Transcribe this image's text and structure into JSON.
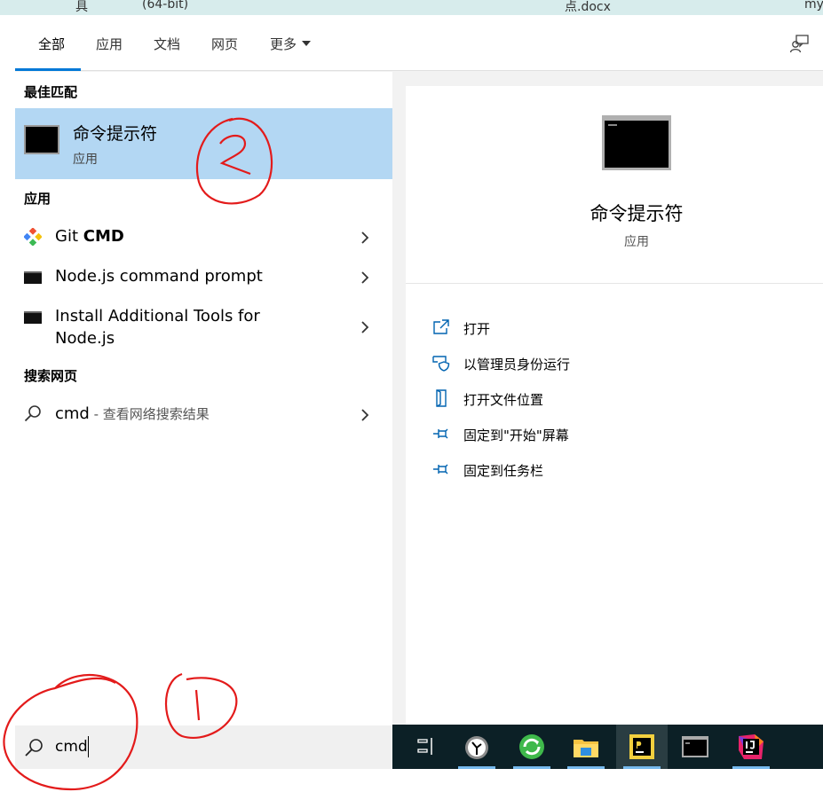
{
  "desktop": {
    "labels": [
      "具",
      "(64-bit)",
      "点.docx",
      "my"
    ]
  },
  "tabs": [
    {
      "label": "全部"
    },
    {
      "label": "应用"
    },
    {
      "label": "文档"
    },
    {
      "label": "网页"
    },
    {
      "label": "更多"
    }
  ],
  "sections": {
    "best_match": "最佳匹配",
    "apps": "应用",
    "web": "搜索网页"
  },
  "best_match": {
    "title": "命令提示符",
    "subtitle": "应用"
  },
  "apps": [
    {
      "name_plain": "Git ",
      "name_bold": "CMD",
      "icon": "git-icon"
    },
    {
      "name": "Node.js command prompt",
      "icon": "console-icon"
    },
    {
      "name_line1": "Install Additional Tools for",
      "name_line2": "Node.js",
      "icon": "console-icon"
    }
  ],
  "web_result": {
    "query": "cmd",
    "suffix": " - 查看网络搜索结果"
  },
  "details": {
    "title": "命令提示符",
    "subtitle": "应用",
    "actions": [
      {
        "label": "打开",
        "icon": "open-icon"
      },
      {
        "label": "以管理员身份运行",
        "icon": "shield-icon"
      },
      {
        "label": "打开文件位置",
        "icon": "file-location-icon"
      },
      {
        "label": "固定到\"开始\"屏幕",
        "icon": "pin-icon"
      },
      {
        "label": "固定到任务栏",
        "icon": "pin-icon"
      }
    ]
  },
  "search": {
    "value": "cmd"
  },
  "taskbar": {
    "items": [
      "task-view-icon",
      "clock-app-icon",
      "green-refresh-app-icon",
      "file-explorer-icon",
      "pycharm-icon",
      "command-prompt-icon",
      "intellij-idea-icon"
    ],
    "accent": "#76b9ed"
  },
  "annotations": {
    "labels": [
      "1",
      "2"
    ],
    "color": "#e31b1b"
  },
  "colors": {
    "selection": "#b3d7f3",
    "tab_underline": "#0078d7",
    "taskbar": "#0c2026",
    "action_icon": "#0063b1"
  }
}
